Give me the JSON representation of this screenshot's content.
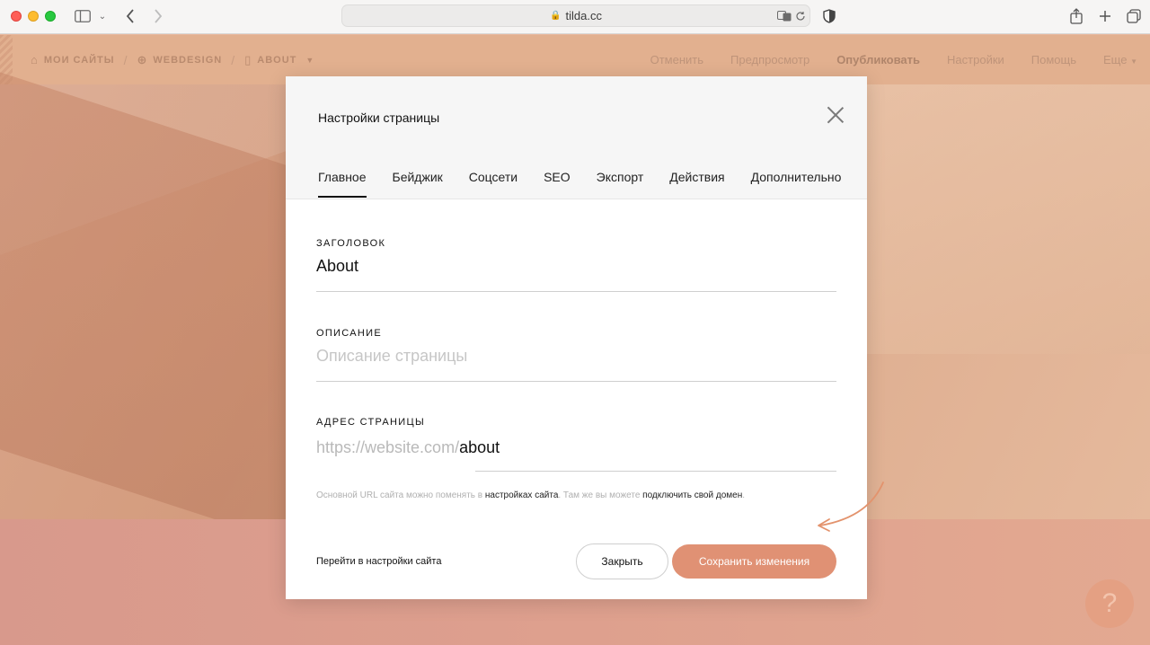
{
  "browser": {
    "url": "tilda.cc"
  },
  "tilda_bar": {
    "breadcrumbs": [
      "МОИ САЙТЫ",
      "WEBDESIGN",
      "ABOUT"
    ],
    "menu": [
      "Отменить",
      "Предпросмотр",
      "Опубликовать",
      "Настройки",
      "Помощь",
      "Еще"
    ]
  },
  "modal": {
    "title": "Настройки страницы",
    "tabs": [
      "Главное",
      "Бейджик",
      "Соцсети",
      "SEO",
      "Экспорт",
      "Действия",
      "Дополнительно"
    ],
    "active_tab": "Главное",
    "fields": {
      "title_label": "ЗАГОЛОВОК",
      "title_value": "About",
      "description_label": "ОПИСАНИЕ",
      "description_placeholder": "Описание страницы",
      "address_label": "АДРЕС СТРАНИЦЫ",
      "address_prefix": "https://website.com/",
      "address_value": "about"
    },
    "hint": {
      "part1": "Основной URL сайта можно поменять в ",
      "link1": "настройках сайта",
      "part2": ". Там же вы можете ",
      "link2": "подключить свой домен",
      "part3": "."
    },
    "footer": {
      "go_settings": "Перейти в настройки сайта",
      "close_label": "Закрыть",
      "save_label": "Сохранить изменения"
    }
  },
  "help_button": "?",
  "colors": {
    "accent": "#e09174",
    "arrow": "#e3936d"
  }
}
